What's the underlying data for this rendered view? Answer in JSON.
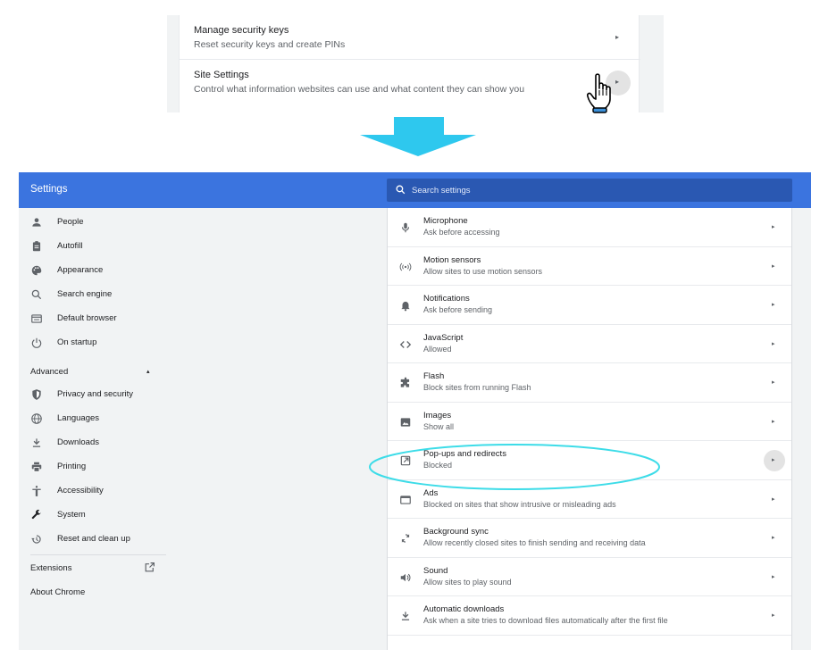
{
  "snippet": {
    "rows": [
      {
        "title": "Manage security keys",
        "subtitle": "Reset security keys and create PINs",
        "arrow": "▸"
      },
      {
        "title": "Site Settings",
        "subtitle": "Control what information websites can use and what content they can show you",
        "arrow": "▸"
      }
    ]
  },
  "app": {
    "title": "Settings",
    "search_placeholder": "Search settings",
    "accent_color": "#3b74df",
    "highlight_color": "#3ddce8"
  },
  "sidebar": {
    "items": [
      {
        "label": "People",
        "icon": "person-icon"
      },
      {
        "label": "Autofill",
        "icon": "clipboard-icon"
      },
      {
        "label": "Appearance",
        "icon": "palette-icon"
      },
      {
        "label": "Search engine",
        "icon": "search-icon"
      },
      {
        "label": "Default browser",
        "icon": "browser-icon"
      },
      {
        "label": "On startup",
        "icon": "power-icon"
      }
    ],
    "advanced_label": "Advanced",
    "advanced_caret": "▴",
    "advanced_items": [
      {
        "label": "Privacy and security",
        "icon": "shield-icon"
      },
      {
        "label": "Languages",
        "icon": "globe-icon"
      },
      {
        "label": "Downloads",
        "icon": "download-icon"
      },
      {
        "label": "Printing",
        "icon": "printer-icon"
      },
      {
        "label": "Accessibility",
        "icon": "accessibility-icon"
      },
      {
        "label": "System",
        "icon": "wrench-icon"
      },
      {
        "label": "Reset and clean up",
        "icon": "restore-icon"
      }
    ],
    "extensions_label": "Extensions",
    "about_label": "About Chrome"
  },
  "permissions": [
    {
      "title": "Microphone",
      "subtitle": "Ask before accessing",
      "icon": "microphone-icon"
    },
    {
      "title": "Motion sensors",
      "subtitle": "Allow sites to use motion sensors",
      "icon": "sensors-icon"
    },
    {
      "title": "Notifications",
      "subtitle": "Ask before sending",
      "icon": "bell-icon"
    },
    {
      "title": "JavaScript",
      "subtitle": "Allowed",
      "icon": "code-icon"
    },
    {
      "title": "Flash",
      "subtitle": "Block sites from running Flash",
      "icon": "puzzle-icon"
    },
    {
      "title": "Images",
      "subtitle": "Show all",
      "icon": "image-icon"
    },
    {
      "title": "Pop-ups and redirects",
      "subtitle": "Blocked",
      "icon": "open-in-new-icon"
    },
    {
      "title": "Ads",
      "subtitle": "Blocked on sites that show intrusive or misleading ads",
      "icon": "ads-window-icon"
    },
    {
      "title": "Background sync",
      "subtitle": "Allow recently closed sites to finish sending and receiving data",
      "icon": "sync-icon"
    },
    {
      "title": "Sound",
      "subtitle": "Allow sites to play sound",
      "icon": "speaker-icon"
    },
    {
      "title": "Automatic downloads",
      "subtitle": "Ask when a site tries to download files automatically after the first file",
      "icon": "download-icon"
    }
  ],
  "row_arrow": "▸"
}
